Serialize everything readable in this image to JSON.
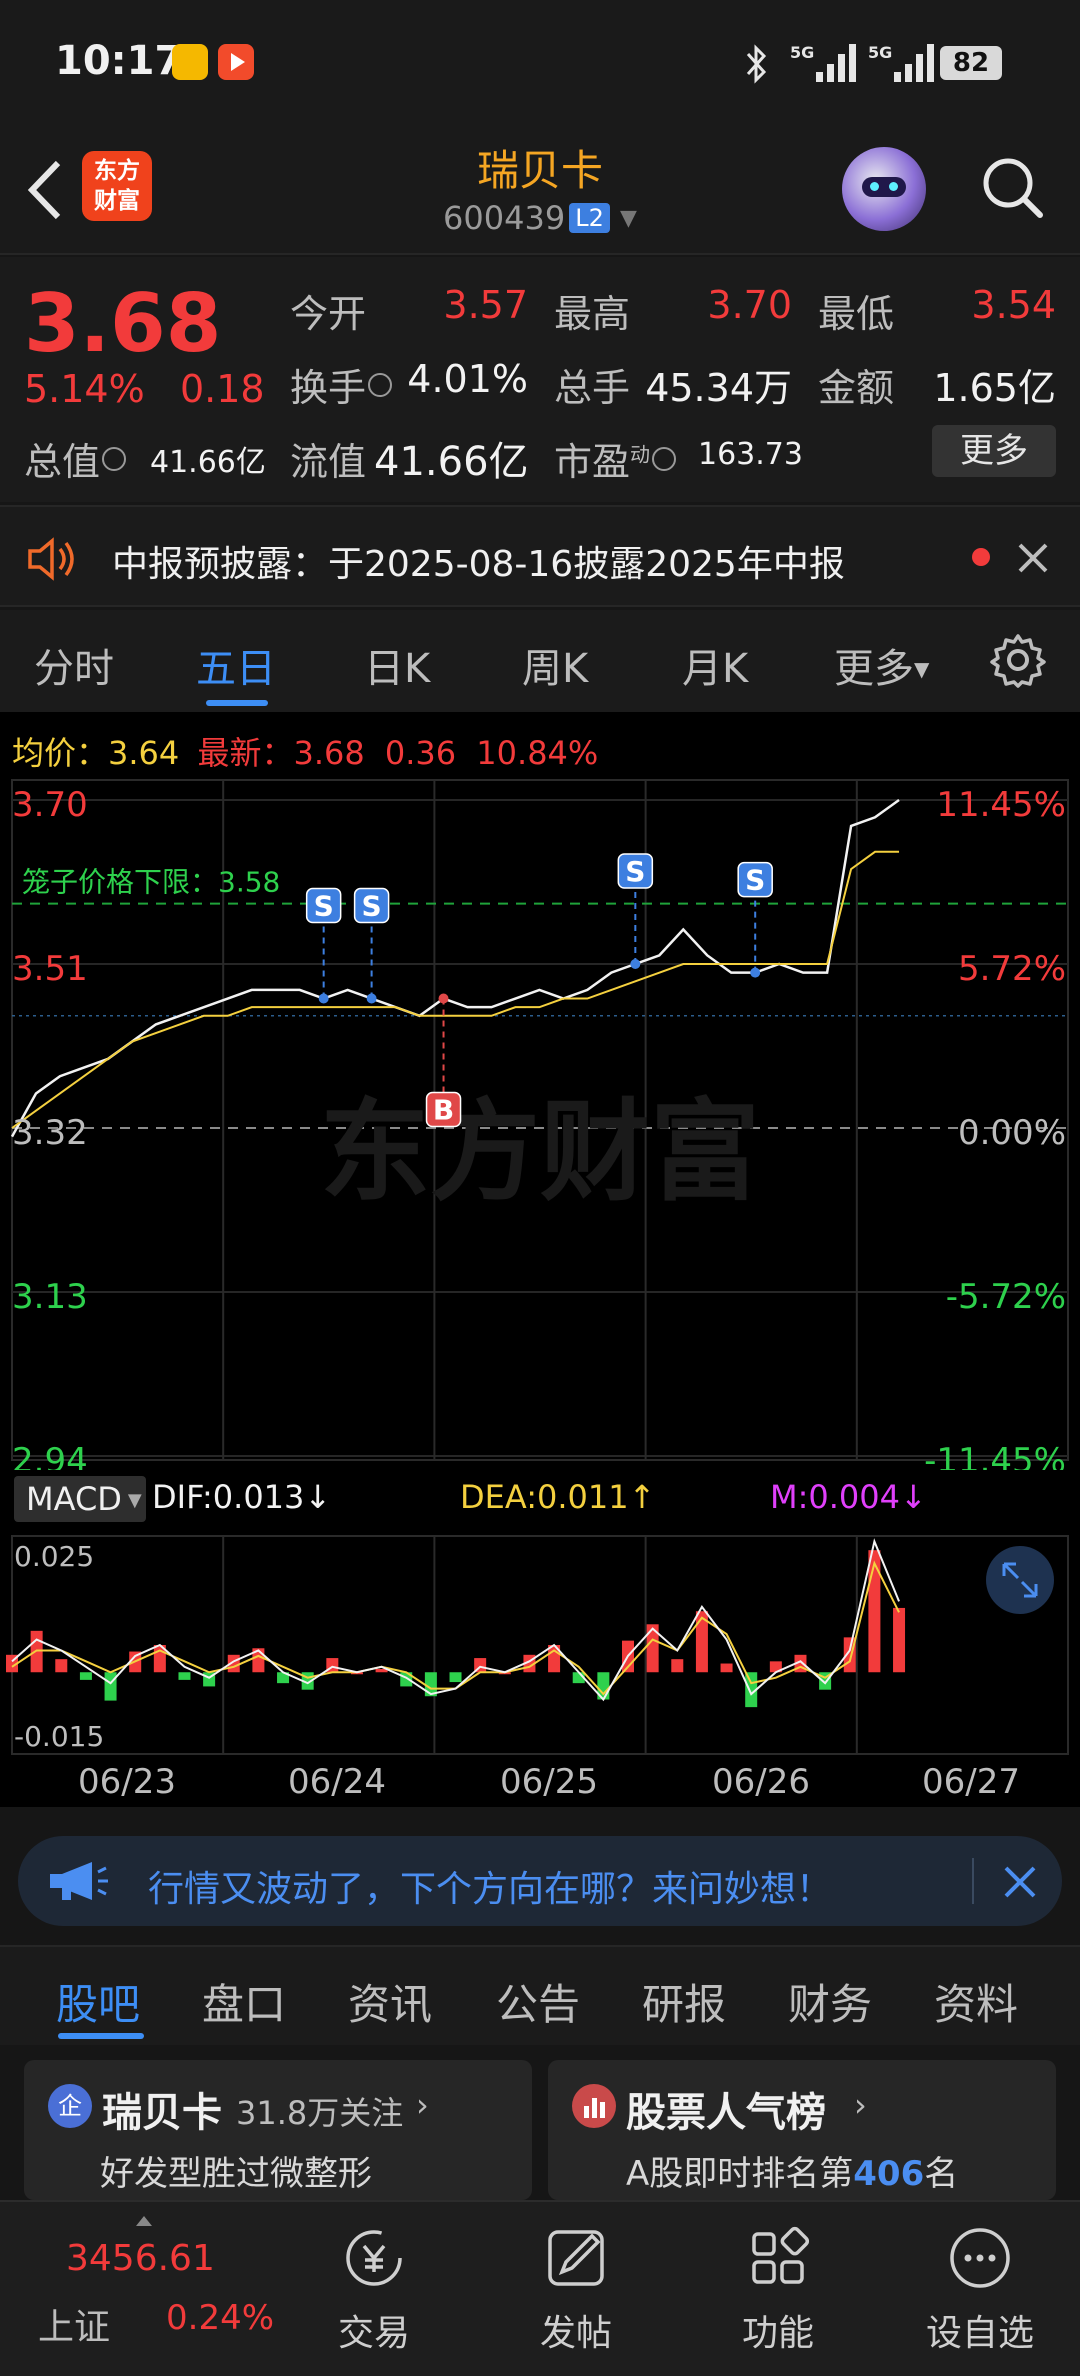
{
  "status_bar": {
    "time": "10:17",
    "battery": "82"
  },
  "header": {
    "stock_name": "瑞贝卡",
    "stock_code": "600439",
    "level_badge": "L2"
  },
  "quote": {
    "price": "3.68",
    "change_pct": "5.14%",
    "change_amt": "0.18",
    "open_label": "今开",
    "open": "3.57",
    "high_label": "最高",
    "high": "3.70",
    "low_label": "最低",
    "low": "3.54",
    "turnover_label": "换手",
    "turnover": "4.01%",
    "volume_label": "总手",
    "volume": "45.34万",
    "amount_label": "金额",
    "amount": "1.65亿",
    "mktcap_label": "总值",
    "mktcap": "41.66亿",
    "float_label": "流值",
    "float_val": "41.66亿",
    "pe_label": "市盈",
    "pe_sup": "动",
    "pe": "163.73",
    "more_label": "更多"
  },
  "notice": {
    "text": "中报预披露：于2025-08-16披露2025年中报"
  },
  "period_tabs": [
    "分时",
    "五日",
    "日K",
    "周K",
    "月K",
    "更多"
  ],
  "chart_header": {
    "avg_label": "均价：",
    "avg": "3.64",
    "latest_label": "最新：",
    "latest": "3.68",
    "change": "0.36",
    "change_pct": "10.84%"
  },
  "chart_data": {
    "type": "line",
    "title": "",
    "x": [
      "06/23",
      "06/24",
      "06/25",
      "06/26",
      "06/27"
    ],
    "y_left_ticks": [
      "3.70",
      "3.51",
      "3.32",
      "3.13",
      "2.94"
    ],
    "y_right_ticks": [
      "11.45%",
      "5.72%",
      "0.00%",
      "-5.72%",
      "-11.45%"
    ],
    "ylim": [
      2.94,
      3.7
    ],
    "reference_price": 3.32,
    "limit_line_label": "笼子价格下限：3.58",
    "limit_line_value": 3.58,
    "series": [
      {
        "name": "price",
        "values": [
          3.31,
          3.36,
          3.38,
          3.39,
          3.4,
          3.42,
          3.44,
          3.45,
          3.46,
          3.47,
          3.48,
          3.48,
          3.48,
          3.47,
          3.48,
          3.47,
          3.46,
          3.45,
          3.47,
          3.46,
          3.46,
          3.47,
          3.48,
          3.47,
          3.48,
          3.5,
          3.51,
          3.52,
          3.55,
          3.52,
          3.5,
          3.5,
          3.51,
          3.5,
          3.5,
          3.67,
          3.68,
          3.7
        ]
      },
      {
        "name": "avg",
        "values": [
          3.32,
          3.34,
          3.36,
          3.38,
          3.4,
          3.42,
          3.43,
          3.44,
          3.45,
          3.45,
          3.46,
          3.46,
          3.46,
          3.46,
          3.46,
          3.46,
          3.46,
          3.45,
          3.45,
          3.45,
          3.45,
          3.46,
          3.46,
          3.47,
          3.47,
          3.48,
          3.49,
          3.5,
          3.51,
          3.51,
          3.51,
          3.51,
          3.51,
          3.51,
          3.51,
          3.62,
          3.64,
          3.64
        ]
      }
    ],
    "markers": [
      {
        "label": "S",
        "type": "sell",
        "index": 13
      },
      {
        "label": "S",
        "type": "sell",
        "index": 15
      },
      {
        "label": "B",
        "type": "buy",
        "index": 18
      },
      {
        "label": "S",
        "type": "sell",
        "index": 26
      },
      {
        "label": "S",
        "type": "sell",
        "index": 31
      }
    ]
  },
  "macd": {
    "button_label": "MACD",
    "dif": "DIF:0.013↓",
    "dea": "DEA:0.011↑",
    "m": "M:0.004↓",
    "y_top": "0.025",
    "y_bottom": "-0.015",
    "ylim": [
      -0.015,
      0.025
    ],
    "colors": {
      "dif": "#f2f2f2",
      "dea": "#f4d03f",
      "pos": "#f23b3b",
      "neg": "#2ed14d"
    },
    "dif_values": [
      0.002,
      0.006,
      0.004,
      0.001,
      -0.002,
      0.003,
      0.005,
      0.001,
      -0.001,
      0.002,
      0.004,
      0.0,
      -0.002,
      0.001,
      0.0,
      0.001,
      -0.001,
      -0.004,
      -0.003,
      0.001,
      0.0,
      0.002,
      0.005,
      0.0,
      -0.005,
      0.003,
      0.008,
      0.004,
      0.012,
      0.006,
      -0.004,
      0.0,
      0.002,
      -0.002,
      0.004,
      0.024,
      0.013
    ],
    "dea_values": [
      0.001,
      0.004,
      0.004,
      0.002,
      0.0,
      0.002,
      0.004,
      0.002,
      0.0,
      0.001,
      0.003,
      0.001,
      -0.001,
      0.0,
      0.0,
      0.001,
      0.0,
      -0.003,
      -0.003,
      0.0,
      0.0,
      0.001,
      0.004,
      0.001,
      -0.004,
      0.001,
      0.006,
      0.004,
      0.01,
      0.007,
      -0.002,
      -0.001,
      0.001,
      -0.001,
      0.002,
      0.02,
      0.011
    ]
  },
  "ai_banner": {
    "text": "行情又波动了，下个方向在哪？来问妙想！"
  },
  "info_tabs": [
    "股吧",
    "盘口",
    "资讯",
    "公告",
    "研报",
    "财务",
    "资料"
  ],
  "cards": {
    "left": {
      "badge": "企",
      "title": "瑞贝卡",
      "followers": "31.8万关注",
      "subtitle": "好发型胜过微整形"
    },
    "right": {
      "title": "股票人气榜",
      "subtitle_prefix": "A股即时排名第",
      "rank": "406",
      "subtitle_suffix": "名"
    }
  },
  "bottom_nav": {
    "index_value": "3456.61",
    "index_name": "上证",
    "index_change": "0.24%",
    "trade": "交易",
    "post": "发帖",
    "functions": "功能",
    "watchlist": "设自选"
  }
}
